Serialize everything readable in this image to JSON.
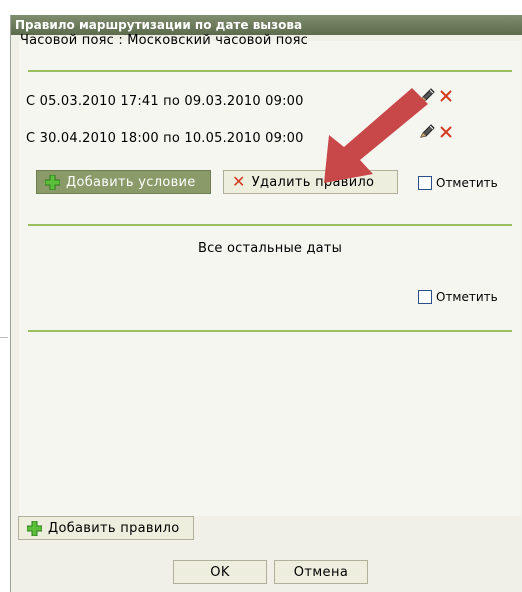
{
  "dialog": {
    "title": "Правило маршрутизации по дате вызова",
    "timezone": "Часовой пояс : Московский часовой пояс",
    "conditions": [
      {
        "text": "С 05.03.2010 17:41 по 09.03.2010 09:00"
      },
      {
        "text": "С 30.04.2010 18:00 по 10.05.2010 09:00"
      }
    ],
    "add_condition_label": "Добавить условие",
    "delete_rule_label": "Удалить правило",
    "mark_label": "Отметить",
    "other_dates_label": "Все остальные даты",
    "add_rule_label": "Добавить правило",
    "ok_label": "OK",
    "cancel_label": "Отмена"
  },
  "colors": {
    "title_bar": "#5c6b4b",
    "separator": "#98c05c",
    "delete_icon": "#d23a1e",
    "annotation_arrow": "#c8484a"
  },
  "icons": [
    "pencil-icon",
    "delete-x-icon",
    "plus-icon",
    "annotation-arrow"
  ]
}
